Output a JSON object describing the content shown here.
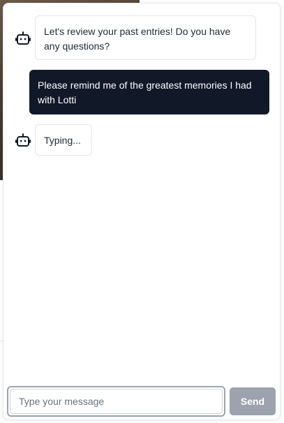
{
  "chat": {
    "messages": [
      {
        "role": "bot",
        "icon": "bot-icon",
        "text": "Let's review your past entries! Do you have any questions?"
      },
      {
        "role": "user",
        "text": "Please remind me of the greatest memories I had with Lotti"
      },
      {
        "role": "bot",
        "icon": "bot-icon",
        "text": "Typing..."
      }
    ]
  },
  "composer": {
    "placeholder": "Type your message",
    "value": "",
    "send_label": "Send"
  },
  "colors": {
    "user_bubble": "#111827",
    "send_button": "#9ca3af",
    "bot_bubble_border": "#e5e7eb"
  }
}
